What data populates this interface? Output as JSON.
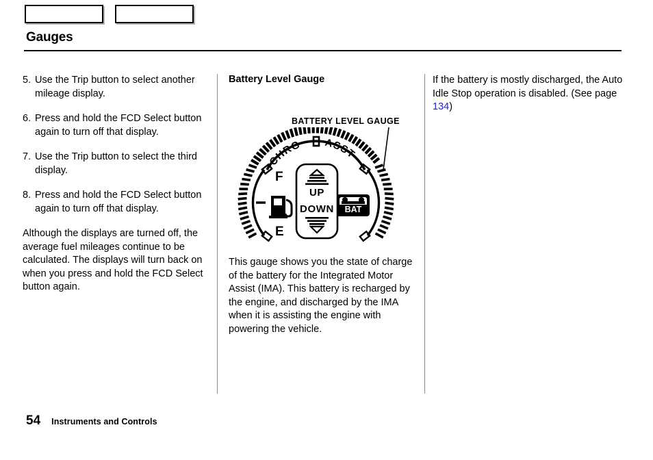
{
  "tabs": [
    {
      "name": "tab-1",
      "label": ""
    },
    {
      "name": "tab-2",
      "label": ""
    }
  ],
  "header": {
    "title": "Gauges"
  },
  "left_column": {
    "steps": [
      {
        "number": "5.",
        "text": "Use the Trip button to select another mileage display."
      },
      {
        "number": "6.",
        "text": "Press and hold the FCD Select button again to turn off that display."
      },
      {
        "number": "7.",
        "text": "Use the Trip button to select the third display."
      },
      {
        "number": "8.",
        "text": "Press and hold the FCD Select button again to turn off that display."
      }
    ],
    "closing_paragraph": "Although the displays are turned off, the average fuel mileages continue to be calculated. The displays will turn back on when you press and hold the FCD Select button again."
  },
  "middle_column": {
    "heading": "Battery Level Gauge",
    "figure": {
      "caption": "BATTERY LEVEL GAUGE",
      "labels": {
        "charge": "CHRG",
        "assist": "ASST",
        "full": "F",
        "empty": "E",
        "up": "UP",
        "down": "DOWN",
        "battery": "BAT"
      }
    },
    "body_paragraph": "This gauge shows you the state of charge of the battery for the Integrated Motor Assist (IMA). This battery is recharged by the engine, and discharged by the IMA when it is assisting the engine with powering the vehicle."
  },
  "right_column": {
    "paragraph_before_link": "If the battery is mostly discharged, the Auto Idle Stop operation is disabled. (See page ",
    "page_link": "134",
    "paragraph_after_link": ")"
  },
  "footer": {
    "page_number": "54",
    "section_name": "Instruments and Controls"
  },
  "colors": {
    "link": "#2222dd",
    "rule": "#000000",
    "divider": "#8a8a8a",
    "text": "#000000"
  }
}
